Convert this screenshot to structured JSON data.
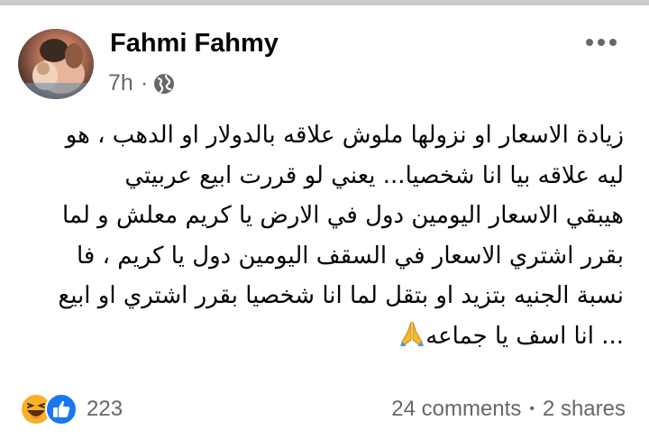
{
  "post": {
    "author": "Fahmi Fahmy",
    "time": "7h",
    "separator": "·",
    "privacy_icon": "globe-icon",
    "more_icon": "more-horizontal-icon",
    "text_lines": [
      "زيادة الاسعار او نزولها ملوش علاقه بالدولار او الدهب ، هو",
      "ليه علاقه بيا انا  شخصيا... يعني  لو قررت ابيع عربيتي",
      "هيبقي الاسعار اليومين دول في الارض يا كريم معلش  و لما",
      "بقرر اشتري الاسعار في السقف اليومين دول يا كريم   ،   فا",
      "نسبة الجنيه بتزيد او بتقل لما انا شخصيا بقرر اشتري او ابيع",
      "... انا اسف يا جماعه"
    ],
    "emoji": "folded-hands-emoji"
  },
  "footer": {
    "reaction_icons": [
      "haha-reaction-icon",
      "like-reaction-icon"
    ],
    "reaction_count": "223",
    "comments": "24 comments",
    "dot": "•",
    "shares": "2 shares"
  },
  "colors": {
    "text": "#050505",
    "secondary": "#65676b",
    "like_blue": "#1877f2",
    "haha_yellow": "#f7b125",
    "top_strip": "#c9ccd1"
  }
}
